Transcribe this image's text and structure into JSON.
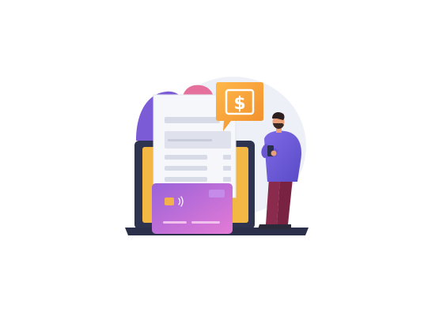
{
  "scene": {
    "alt": "",
    "badge_symbol": "$",
    "colors": {
      "background": "#ffffff",
      "blob_lavender": "#eceff7",
      "blob_purple": "#7b5cd6",
      "blob_pink": "#e7739b",
      "laptop_dark": "#2b2f4a",
      "laptop_screen": "#f1b94a",
      "invoice_paper": "#f7f8fc",
      "invoice_lines": "#d6d9e6",
      "card_gradient_start": "#9d6ae0",
      "card_gradient_end": "#e07ad8",
      "badge_orange": "#f7a43a",
      "person_shirt": "#7d66e0",
      "person_pants": "#8b2a4a",
      "person_skin": "#e8a07a",
      "person_hair": "#2b1f1f"
    },
    "icons": [
      "dollar-sign-icon",
      "credit-card-chip-icon",
      "contactless-icon"
    ]
  }
}
